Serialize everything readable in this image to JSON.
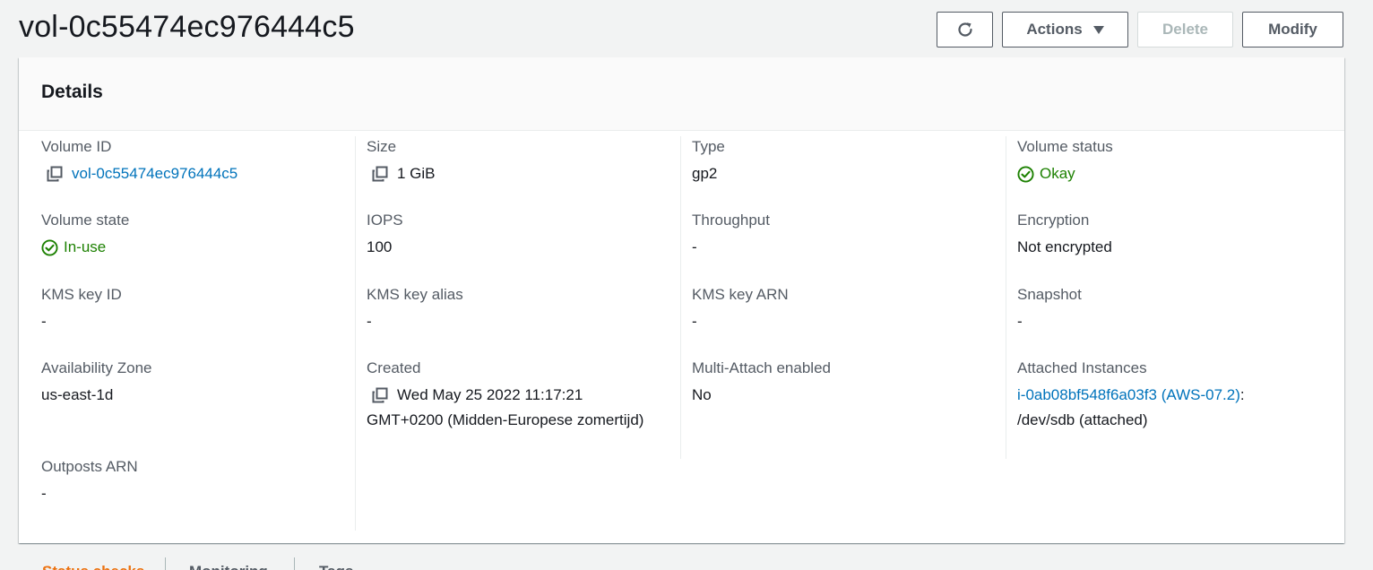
{
  "header": {
    "title": "vol-0c55474ec976444c5",
    "refresh_icon": "refresh-icon",
    "actions_label": "Actions",
    "delete_label": "Delete",
    "modify_label": "Modify"
  },
  "details": {
    "title": "Details",
    "volume_id": {
      "label": "Volume ID",
      "value": "vol-0c55474ec976444c5"
    },
    "volume_state": {
      "label": "Volume state",
      "value": "In-use"
    },
    "kms_key_id": {
      "label": "KMS key ID",
      "value": "-"
    },
    "availability_zone": {
      "label": "Availability Zone",
      "value": "us-east-1d"
    },
    "outposts_arn": {
      "label": "Outposts ARN",
      "value": "-"
    },
    "size": {
      "label": "Size",
      "value": "1 GiB"
    },
    "iops": {
      "label": "IOPS",
      "value": "100"
    },
    "kms_key_alias": {
      "label": "KMS key alias",
      "value": "-"
    },
    "created": {
      "label": "Created",
      "value_line1": "Wed May 25 2022 11:17:21",
      "value_line2": "GMT+0200 (Midden-Europese zomertijd)"
    },
    "type": {
      "label": "Type",
      "value": "gp2"
    },
    "throughput": {
      "label": "Throughput",
      "value": "-"
    },
    "kms_key_arn": {
      "label": "KMS key ARN",
      "value": "-"
    },
    "multi_attach": {
      "label": "Multi-Attach enabled",
      "value": "No"
    },
    "volume_status": {
      "label": "Volume status",
      "value": "Okay"
    },
    "encryption": {
      "label": "Encryption",
      "value": "Not encrypted"
    },
    "snapshot": {
      "label": "Snapshot",
      "value": "-"
    },
    "attached_instances": {
      "label": "Attached Instances",
      "instance_link": "i-0ab08bf548f6a03f3 (AWS-07.2)",
      "suffix": ":",
      "device": "/dev/sdb (attached)"
    }
  },
  "tabs": [
    {
      "label": "Status checks"
    },
    {
      "label": "Monitoring"
    },
    {
      "label": "Tags"
    }
  ],
  "colors": {
    "link": "#0073bb",
    "success": "#1d8102",
    "active_tab": "#ec7211"
  }
}
